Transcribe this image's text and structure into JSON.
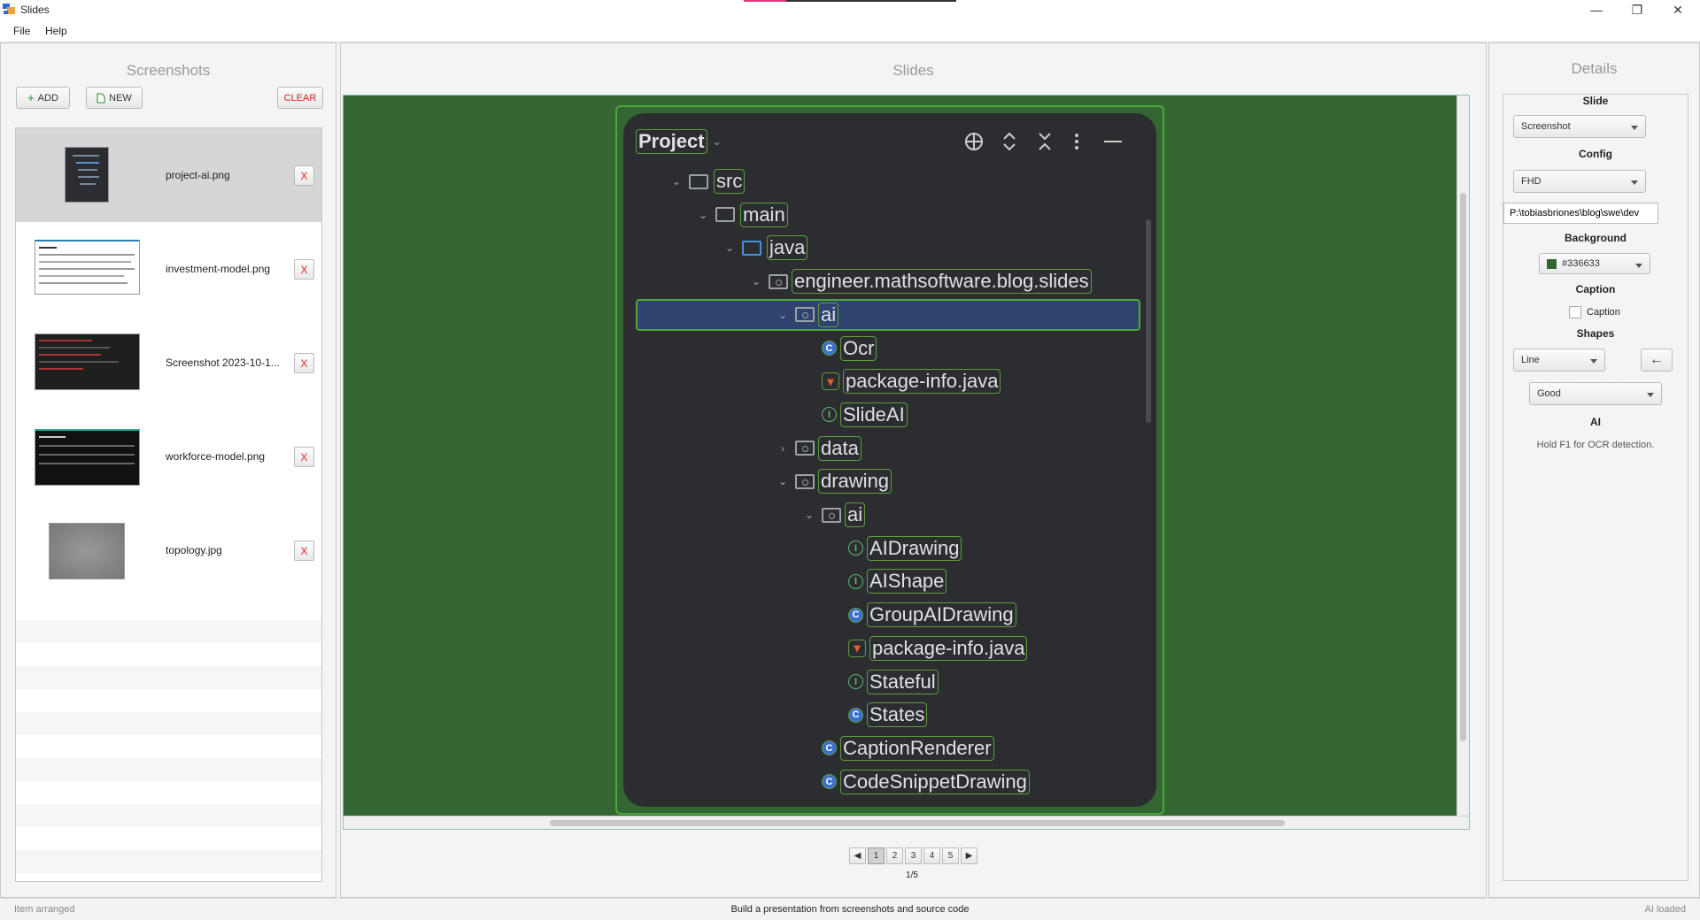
{
  "window": {
    "title": "Slides",
    "minimize": "—",
    "restore": "❐",
    "close": "✕"
  },
  "menu": {
    "file": "File",
    "help": "Help"
  },
  "screenshots_panel": {
    "title": "Screenshots",
    "add_label": "ADD",
    "new_label": "NEW",
    "clear_label": "CLEAR",
    "items": [
      {
        "name": "project-ai.png",
        "delete": "X"
      },
      {
        "name": "investment-model.png",
        "delete": "X"
      },
      {
        "name": "Screenshot 2023-10-1...",
        "delete": "X"
      },
      {
        "name": "workforce-model.png",
        "delete": "X"
      },
      {
        "name": "topology.jpg",
        "delete": "X"
      }
    ]
  },
  "slides_panel": {
    "title": "Slides",
    "page_indicator": "1/5",
    "pages": [
      "1",
      "2",
      "3",
      "4",
      "5"
    ],
    "background_color": "#336633",
    "project_tool": {
      "title": "Project",
      "tree": [
        {
          "label": "src",
          "depth": 0,
          "icon": "folder",
          "chevron": "down"
        },
        {
          "label": "main",
          "depth": 1,
          "icon": "folder",
          "chevron": "down"
        },
        {
          "label": "java",
          "depth": 2,
          "icon": "folder-blue",
          "chevron": "down"
        },
        {
          "label": "engineer.mathsoftware.blog.slides",
          "depth": 3,
          "icon": "package",
          "chevron": "down"
        },
        {
          "label": "ai",
          "depth": 4,
          "icon": "package",
          "chevron": "down",
          "selected": true
        },
        {
          "label": "Ocr",
          "depth": 5,
          "icon": "class"
        },
        {
          "label": "package-info.java",
          "depth": 5,
          "icon": "package-info"
        },
        {
          "label": "SlideAI",
          "depth": 5,
          "icon": "interface"
        },
        {
          "label": "data",
          "depth": 4,
          "icon": "package",
          "chevron": "right"
        },
        {
          "label": "drawing",
          "depth": 4,
          "icon": "package",
          "chevron": "down"
        },
        {
          "label": "ai",
          "depth": 5,
          "icon": "package",
          "chevron": "down"
        },
        {
          "label": "AIDrawing",
          "depth": 6,
          "icon": "interface"
        },
        {
          "label": "AIShape",
          "depth": 6,
          "icon": "interface"
        },
        {
          "label": "GroupAIDrawing",
          "depth": 6,
          "icon": "class"
        },
        {
          "label": "package-info.java",
          "depth": 6,
          "icon": "package-info"
        },
        {
          "label": "Stateful",
          "depth": 6,
          "icon": "interface"
        },
        {
          "label": "States",
          "depth": 6,
          "icon": "class"
        },
        {
          "label": "CaptionRenderer",
          "depth": 5,
          "icon": "class"
        },
        {
          "label": "CodeSnippetDrawing",
          "depth": 5,
          "icon": "class"
        }
      ]
    }
  },
  "details_panel": {
    "title": "Details",
    "slide_label": "Slide",
    "slide_value": "Screenshot",
    "config_label": "Config",
    "config_value": "FHD",
    "path_value": "P:\\tobiasbriones\\blog\\swe\\dev",
    "background_label": "Background",
    "background_value": "#336633",
    "caption_label": "Caption",
    "caption_checkbox": "Caption",
    "shapes_label": "Shapes",
    "shape_value": "Line",
    "quality_value": "Good",
    "ai_label": "AI",
    "ai_hint": "Hold F1 for OCR detection."
  },
  "status": {
    "left": "Item arranged",
    "center": "Build a presentation from screenshots and source code",
    "right": "AI loaded"
  }
}
